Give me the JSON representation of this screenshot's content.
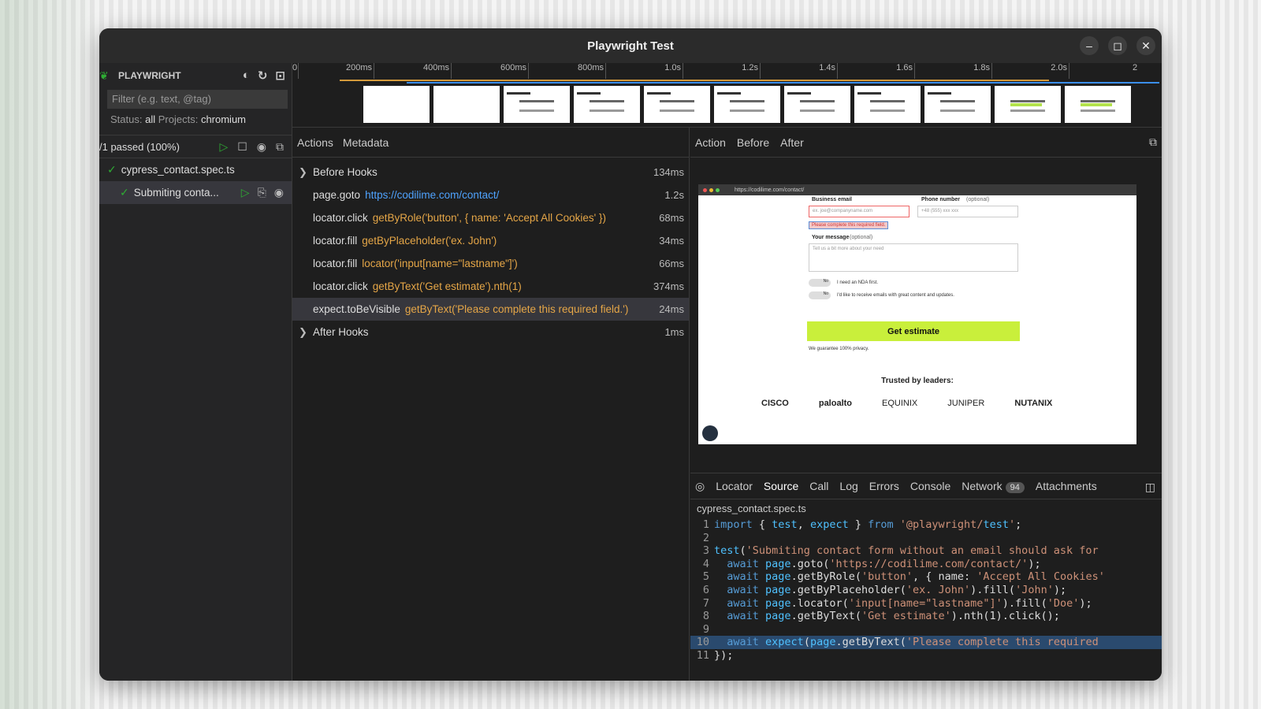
{
  "window": {
    "title": "Playwright Test"
  },
  "sidebar": {
    "brand": "PLAYWRIGHT",
    "filter_placeholder": "Filter (e.g. text, @tag)",
    "status_label": "Status:",
    "status_value": "all",
    "projects_label": "Projects:",
    "projects_value": "chromium",
    "passed": "/1 passed (100%)",
    "file": "cypress_contact.spec.ts",
    "test": "Submiting conta..."
  },
  "timeline": {
    "ticks": [
      "0",
      "200ms",
      "400ms",
      "600ms",
      "800ms",
      "1.0s",
      "1.2s",
      "1.4s",
      "1.6s",
      "1.8s",
      "2.0s",
      "2"
    ]
  },
  "actions_panel": {
    "tabs": [
      "Actions",
      "Metadata"
    ],
    "items": [
      {
        "name": "Before Hooks",
        "selector": "",
        "duration": "134ms"
      },
      {
        "name": "page.goto",
        "selector": "https://codilime.com/contact/",
        "duration": "1.2s"
      },
      {
        "name": "locator.click",
        "selector": "getByRole('button', { name: 'Accept All Cookies' })",
        "duration": "68ms"
      },
      {
        "name": "locator.fill",
        "selector": "getByPlaceholder('ex. John')",
        "duration": "34ms"
      },
      {
        "name": "locator.fill",
        "selector": "locator('input[name=\"lastname\"]')",
        "duration": "66ms"
      },
      {
        "name": "locator.click",
        "selector": "getByText('Get estimate').nth(1)",
        "duration": "374ms"
      },
      {
        "name": "expect.toBeVisible",
        "selector": "getByText('Please complete this required field.')",
        "duration": "24ms"
      },
      {
        "name": "After Hooks",
        "selector": "",
        "duration": "1ms"
      }
    ]
  },
  "snapshot_tabs": [
    "Action",
    "Before",
    "After"
  ],
  "snapshot": {
    "url": "https://codilime.com/contact/",
    "business_email": "Business email",
    "phone_number": "Phone number",
    "optional": "(optional)",
    "email_placeholder": "ex. joe@companyname.com",
    "phone_placeholder": "+48 (555) xxx xxx",
    "error": "Please complete this required field.",
    "your_message": "Your message",
    "message_placeholder": "Tell us a bit more about your need",
    "toggle_no": "No",
    "nda": "I need an NDA first.",
    "emails": "I'd like to receive emails with great content and updates.",
    "get_estimate": "Get estimate",
    "privacy": "We guarantee 100% privacy.",
    "trusted": "Trusted by leaders:",
    "logos": [
      "CISCO",
      "paloalto",
      "EQUINIX",
      "JUNIPER",
      "NUTANIX"
    ]
  },
  "bottom_tabs": {
    "items": [
      "Locator",
      "Source",
      "Call",
      "Log",
      "Errors",
      "Console",
      "Network",
      "Attachments"
    ],
    "network_count": "94"
  },
  "source": {
    "file": "cypress_contact.spec.ts",
    "lines": [
      "import { test, expect } from '@playwright/test';",
      "",
      "test('Submiting contact form without an email should ask for",
      "  await page.goto('https://codilime.com/contact/');",
      "  await page.getByRole('button', { name: 'Accept All Cookies'",
      "  await page.getByPlaceholder('ex. John').fill('John');",
      "  await page.locator('input[name=\"lastname\"]').fill('Doe');",
      "  await page.getByText('Get estimate').nth(1).click();",
      "",
      "  await expect(page.getByText('Please complete this required",
      "});"
    ],
    "highlighted_line": 10
  }
}
